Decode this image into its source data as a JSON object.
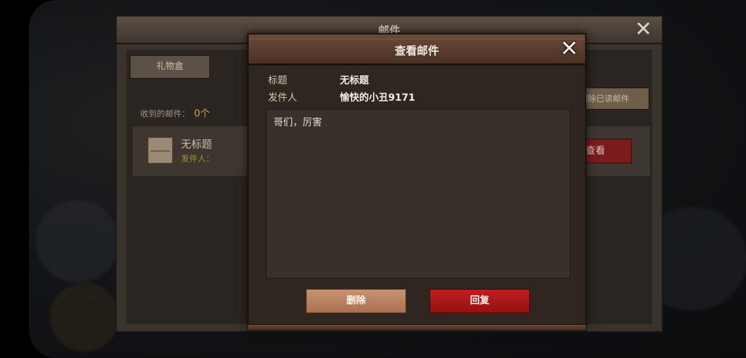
{
  "outer_window": {
    "title": "邮件",
    "close_glyph": "✕",
    "tab_gift_box": "礼物盒",
    "received_label": "收到的邮件：",
    "received_count": "0个",
    "delete_read_button": "删除已读邮件",
    "mail_item": {
      "title": "无标题",
      "sender_prefix": "发件人：",
      "view_button": "查看"
    }
  },
  "modal": {
    "title": "查看邮件",
    "close_glyph": "✕",
    "subject_label": "标题",
    "subject_value": "无标题",
    "sender_label": "发件人",
    "sender_value": "愉快的小丑9171",
    "body_text": "哥们，厉害",
    "delete_button": "删除",
    "reply_button": "回复"
  },
  "icons": {
    "close": "close-icon",
    "mail": "envelope-icon"
  },
  "colors": {
    "reply_button": "#a81717",
    "delete_button": "#b87e5c",
    "modal_header": "#5b3c2d"
  }
}
